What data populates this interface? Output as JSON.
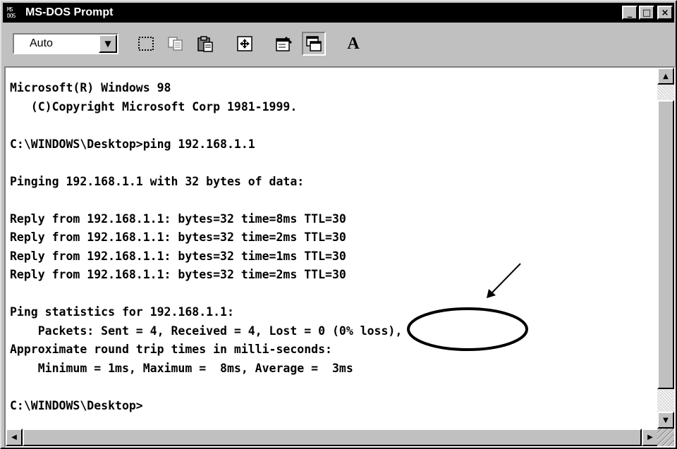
{
  "window": {
    "title": "MS-DOS Prompt",
    "app_icon": "ms-dos-icon",
    "app_icon_text_top": "MS",
    "app_icon_text_bottom": "DOS",
    "minimize_glyph": "_",
    "maximize_glyph": "□",
    "close_glyph": "×"
  },
  "toolbar": {
    "font_size_value": "Auto",
    "dropdown_glyph": "▼",
    "buttons": [
      {
        "icon": "mark-icon"
      },
      {
        "icon": "copy-icon"
      },
      {
        "icon": "paste-icon"
      },
      {
        "icon": "full-screen-icon"
      },
      {
        "icon": "properties-icon"
      },
      {
        "icon": "background-icon"
      },
      {
        "icon": "font-icon",
        "label": "A"
      }
    ]
  },
  "console": {
    "lines": [
      "Microsoft(R) Windows 98",
      "   (C)Copyright Microsoft Corp 1981-1999.",
      "",
      "C:\\WINDOWS\\Desktop>ping 192.168.1.1",
      "",
      "Pinging 192.168.1.1 with 32 bytes of data:",
      "",
      "Reply from 192.168.1.1: bytes=32 time=8ms TTL=30",
      "Reply from 192.168.1.1: bytes=32 time=2ms TTL=30",
      "Reply from 192.168.1.1: bytes=32 time=1ms TTL=30",
      "Reply from 192.168.1.1: bytes=32 time=2ms TTL=30",
      "",
      "Ping statistics for 192.168.1.1:",
      "    Packets: Sent = 4, Received = 4, Lost = 0 (0% loss),",
      "Approximate round trip times in milli-seconds:",
      "    Minimum = 1ms, Maximum =  8ms, Average =  3ms",
      "",
      "C:\\WINDOWS\\Desktop>"
    ]
  },
  "scrollbars": {
    "up_glyph": "▲",
    "down_glyph": "▼",
    "left_glyph": "◀",
    "right_glyph": "▶"
  },
  "annotation": {
    "target": "(0% loss)",
    "shape": "ellipse-with-arrow",
    "color": "#000000"
  },
  "colors": {
    "titlebar": "#000000",
    "chrome": "#c0c0c0",
    "console_background": "#ffffff",
    "console_text": "#000000"
  }
}
